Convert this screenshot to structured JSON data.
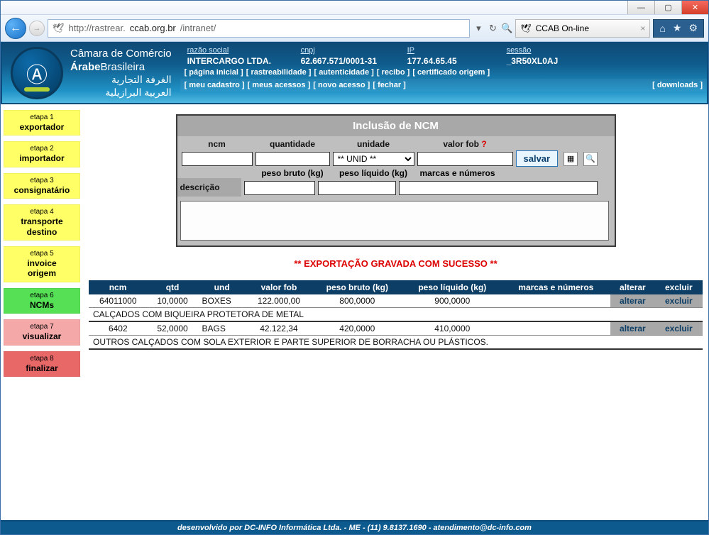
{
  "window": {
    "url_prefix": "http://rastrear.",
    "url_host": "ccab.org.br",
    "url_suffix": "/intranet/",
    "tab_title": "CCAB On-line"
  },
  "brand": {
    "line1a": "Câmara",
    "line1b": " de Comércio",
    "line2a": "Árabe",
    "line2b": "Brasileira",
    "ar1": "الغرفة التجارية",
    "ar2": "العربية البرازيلية"
  },
  "info": {
    "razao_label": "razão social",
    "razao": "INTERCARGO LTDA.",
    "cnpj_label": "cnpj",
    "cnpj": "62.667.571/0001-31",
    "ip_label": "IP",
    "ip": "177.64.65.45",
    "sessao_label": "sessão",
    "sessao": "_3R50XL0AJ"
  },
  "nav1": {
    "pagina": "página inicial",
    "rastre": "rastreabilidade",
    "autent": "autenticidade",
    "recibo": "recibo",
    "cert": "certificado origem"
  },
  "nav2": {
    "cadastro": "meu cadastro",
    "acessos": "meus acessos",
    "novo": "novo acesso",
    "fechar": "fechar",
    "downloads": "downloads"
  },
  "steps": {
    "s1l": "etapa 1",
    "s1": "exportador",
    "s2l": "etapa 2",
    "s2": "importador",
    "s3l": "etapa 3",
    "s3": "consignatário",
    "s4l": "etapa 4",
    "s4a": "transporte",
    "s4b": "destino",
    "s5l": "etapa 5",
    "s5a": "invoice",
    "s5b": "origem",
    "s6l": "etapa 6",
    "s6": "NCMs",
    "s7l": "etapa 7",
    "s7": "visualizar",
    "s8l": "etapa 8",
    "s8": "finalizar"
  },
  "form": {
    "title": "Inclusão de NCM",
    "h_ncm": "ncm",
    "h_qtd": "quantidade",
    "h_und": "unidade",
    "h_fob": "valor fob",
    "und_selected": "** UNID **",
    "h_pbruto": "peso bruto (kg)",
    "h_pliq": "peso líquido (kg)",
    "h_marcas": "marcas e números",
    "save": "salvar",
    "desc_label": "descrição"
  },
  "success": "** EXPORTAÇÃO GRAVADA COM SUCESSO **",
  "table": {
    "headers": {
      "ncm": "ncm",
      "qtd": "qtd",
      "und": "und",
      "fob": "valor fob",
      "pbruto": "peso bruto (kg)",
      "pliq": "peso líquido (kg)",
      "marcas": "marcas e números",
      "alterar": "alterar",
      "excluir": "excluir"
    },
    "rows": [
      {
        "ncm": "64011000",
        "qtd": "10,0000",
        "und": "BOXES",
        "fob": "122.000,00",
        "pbruto": "800,0000",
        "pliq": "900,0000",
        "marcas": "",
        "desc": "CALÇADOS COM BIQUEIRA PROTETORA DE METAL",
        "alterar": "alterar",
        "excluir": "excluir"
      },
      {
        "ncm": "6402",
        "qtd": "52,0000",
        "und": "BAGS",
        "fob": "42.122,34",
        "pbruto": "420,0000",
        "pliq": "410,0000",
        "marcas": "",
        "desc": "OUTROS CALÇADOS COM SOLA EXTERIOR E PARTE SUPERIOR DE BORRACHA OU PLÁSTICOS.",
        "alterar": "alterar",
        "excluir": "excluir"
      }
    ]
  },
  "footer": "desenvolvido por  DC-INFO Informática Ltda. - ME  - (11) 9.8137.1690  - atendimento@dc-info.com"
}
